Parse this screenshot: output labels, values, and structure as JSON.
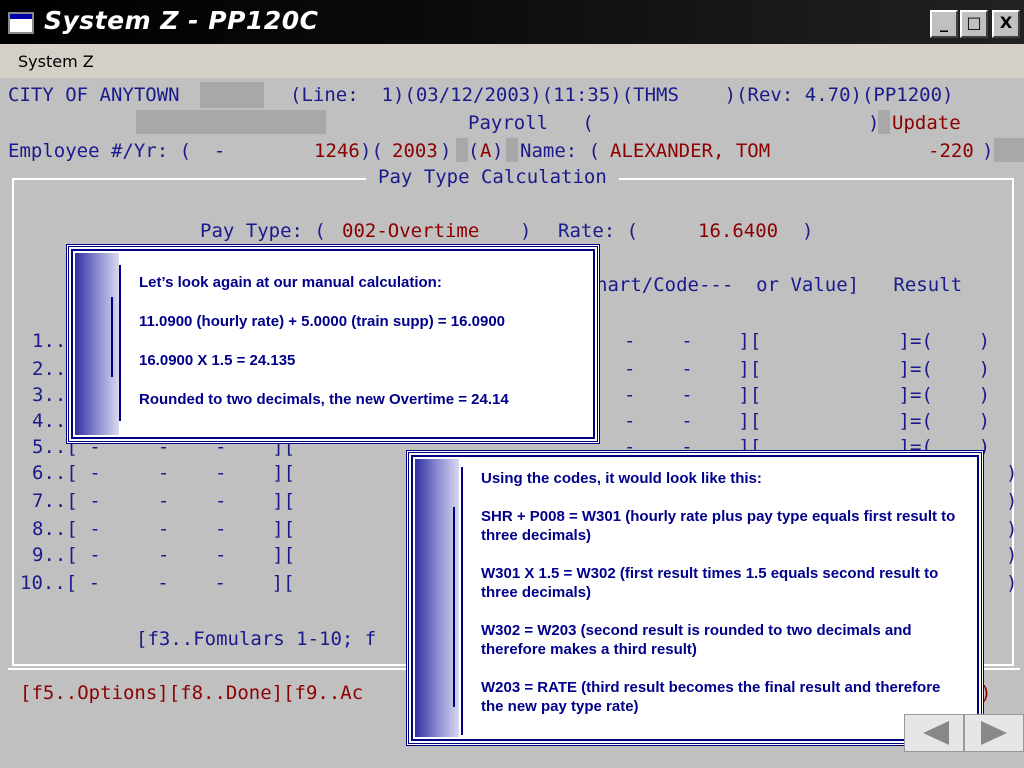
{
  "window": {
    "title": "System Z - PP120C",
    "minimize": "_",
    "maximize": "□",
    "close": "X"
  },
  "menu": {
    "system_z": "System Z"
  },
  "header": {
    "city": "CITY OF ANYTOWN",
    "line_info": "(Line:  1)(03/12/2003)(11:35)(THMS    )(Rev: 4.70)(PP1200)",
    "payroll": "Payroll   (",
    "payroll_close": ")",
    "update": "Update",
    "emp_label": "Employee #/Yr: (  -",
    "emp_num": "1246",
    "emp_sep": ")(",
    "emp_year": "2003",
    "emp_close": ")",
    "status_open": "(",
    "status": "A",
    "status_close": ")",
    "name_label": "Name: (",
    "name": "ALEXANDER, TOM",
    "dept_num": "-220",
    "dept_close": ")"
  },
  "panel": {
    "title": "Pay Type Calculation",
    "pay_type_label": "Pay Type: (",
    "pay_type": "002-Overtime",
    "pay_type_close": ")",
    "rate_label": "Rate: (",
    "rate": "16.6400",
    "rate_close": ")",
    "col_header": "hart/Code---  or Value]   Result",
    "rows_left": [
      "1..",
      "2..",
      "3..",
      "4..",
      "5..[ -     -    -    ][",
      "6..[ -     -    -    ][",
      "7..[ -     -    -    ][",
      "8..[ -     -    -    ][",
      "9..[ -     -    -    ][",
      "10..[ -     -    -    ]["
    ],
    "rows_right": [
      "-    -    ][            ]=(    )",
      "-    -    ][            ]=(    )",
      "-    -    ][            ]=(    )",
      "-    -    ][            ]=(    )",
      "-    -    ][            ]=(    )"
    ],
    "right_paren": ")",
    "footer_formulas": "[f3..Fomulars 1-10; f",
    "fkeys": "[f5..Options][f8..Done][f9..Ac"
  },
  "callout1": {
    "lines": [
      "Let’s look again at our manual calculation:",
      "11.0900 (hourly rate) + 5.0000 (train supp) = 16.0900",
      "16.0900 X 1.5 = 24.135",
      "Rounded to two decimals, the new Overtime = 24.14"
    ]
  },
  "callout2": {
    "lines": [
      "Using the codes, it would look like this:",
      "SHR + P008 = W301 (hourly rate plus pay type equals first result to three decimals)",
      "W301 X 1.5 = W302 (first result times 1.5 equals second result to three decimals)",
      "W302 = W203 (second result is rounded to two decimals and therefore makes a third result)",
      "W203 = RATE (third result becomes the final result and therefore the new pay type rate)"
    ]
  },
  "nav": {
    "prev": "◀",
    "next": "▶"
  },
  "colors": {
    "text_blue": "#1a1a8c",
    "text_red": "#8b0000",
    "callout_text": "#00008b",
    "screen_bg": "#c0c0c0"
  }
}
